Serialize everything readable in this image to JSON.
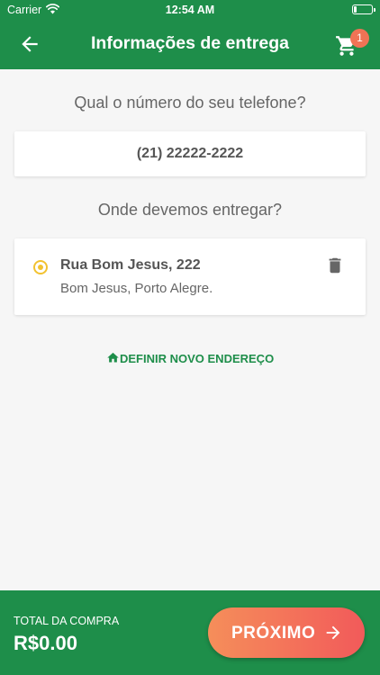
{
  "status_bar": {
    "carrier": "Carrier",
    "time": "12:54 AM",
    "battery_level": 0.15
  },
  "header": {
    "title": "Informações de entrega",
    "cart_count": "1",
    "back_icon": "arrow-left-icon",
    "cart_icon": "cart-icon"
  },
  "phone_section": {
    "question": "Qual o número do seu telefone?",
    "value": "(21) 22222-2222"
  },
  "address_section": {
    "question": "Onde devemos entregar?",
    "addresses": [
      {
        "street": "Rua Bom Jesus, 222",
        "city": "Bom Jesus, Porto Alegre.",
        "selected": true
      }
    ],
    "new_address_label": "DEFINIR NOVO ENDEREÇO"
  },
  "footer": {
    "total_label": "TOTAL DA COMPRA",
    "total_value": "R$0.00",
    "next_label": "PRÓXIMO"
  },
  "colors": {
    "primary_green": "#1e8e4a",
    "radio_yellow": "#f2c230",
    "badge_orange": "#f07355",
    "button_gradient_start": "#f58e5a",
    "button_gradient_end": "#f25a5a"
  }
}
